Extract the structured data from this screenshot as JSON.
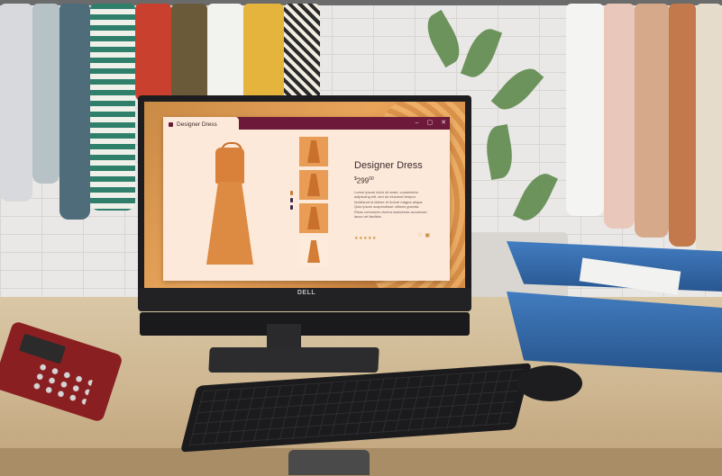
{
  "scene": {
    "description_objects": [
      "clothing-rack",
      "monitor",
      "keyboard",
      "mouse",
      "payment-terminal",
      "document-tray",
      "plant"
    ]
  },
  "monitor": {
    "brand": "DELL"
  },
  "app": {
    "window_title": "Designer Dress",
    "window_controls": {
      "minimize": "–",
      "maximize": "▢",
      "close": "✕"
    },
    "product": {
      "title": "Designer Dress",
      "price_currency": "$",
      "price_whole": "299",
      "price_cents": "00",
      "description": "Lorem ipsum dolor sit amet, consectetur adipiscing elit, sed do eiusmod tempor incididunt ut labore et dolore magna aliqua. Quis ipsum suspendisse ultrices gravida. Risus commodo viverra maecenas accumsan lacus vel facilisis.",
      "rating_stars": "★★★★★"
    },
    "actions": {
      "wishlist_icon": "♡",
      "cart_icon": "▣"
    },
    "accent_color": "#6d1a3a",
    "background_color": "#fde9d9"
  }
}
